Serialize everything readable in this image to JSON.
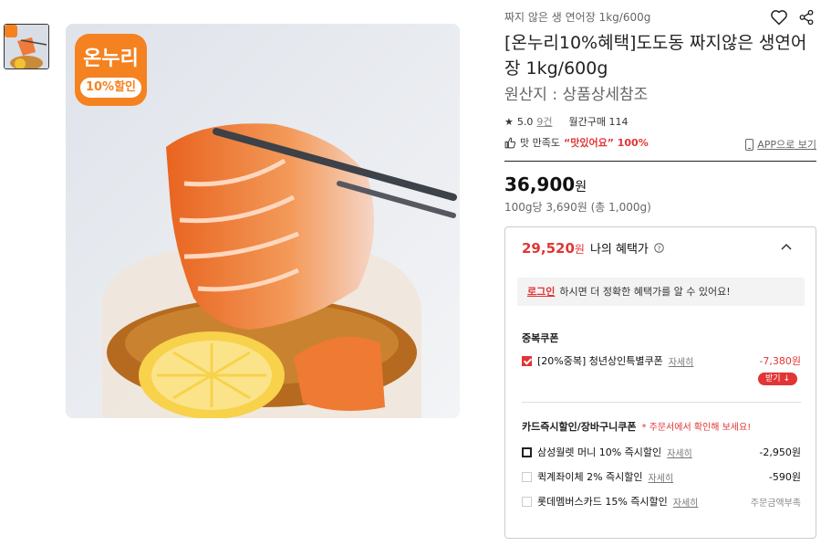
{
  "gallery": {
    "badge_title": "온누리",
    "badge_discount": "10%할인"
  },
  "product": {
    "breadcrumb": "짜지 않은 생 연어장 1kg/600g",
    "title": "[온누리10%혜택]도도동 짜지않은 생연어장 1kg/600g",
    "origin": "원산지 : 상품상세참조",
    "rating": "5.0",
    "review_count": "9건",
    "monthly_purchase": "월간구매 114",
    "satisfaction_label": "맛 만족도",
    "satisfaction_value": "“맛있어요” 100%",
    "app_link": "APP으로 보기",
    "price": "36,900",
    "price_unit": "원",
    "unit_price": "100g당 3,690원 (총 1,000g)"
  },
  "benefit": {
    "amount": "29,520",
    "unit": "원",
    "label": "나의 혜택가",
    "login_link": "로그인",
    "login_text": "하시면 더 정확한 혜택가를 알 수 있어요!"
  },
  "coupons": {
    "dup_title": "중복쿠폰",
    "dup_item": "[20%중복] 청년상인특별쿠폰",
    "dup_detail": "자세히",
    "dup_amount": "-7,380원",
    "download": "받기 ↓",
    "card_title": "카드즉시할인/장바구니쿠폰",
    "card_note": "* 주문서에서 확인해 보세요!",
    "cards": [
      {
        "label": "삼성월렛 머니 10% 즉시할인",
        "detail": "자세히",
        "amount": "-2,950원"
      },
      {
        "label": "퀵계좌이체 2% 즉시할인",
        "detail": "자세히",
        "amount": "-590원"
      },
      {
        "label": "롯데멤버스카드 15% 즉시할인",
        "detail": "자세히",
        "amount": "주문금액부족"
      }
    ]
  },
  "colors": {
    "accent": "#e23535",
    "badge": "#f58220"
  }
}
